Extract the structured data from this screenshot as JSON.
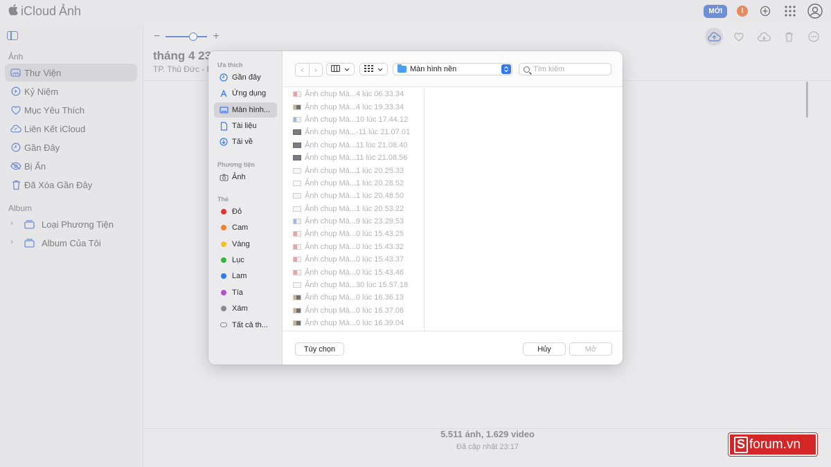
{
  "app": {
    "brand": "iCloud",
    "title": "Ảnh"
  },
  "topbar": {
    "new_badge": "MỚI",
    "warn_symbol": "!"
  },
  "sidebar": {
    "section_photos": "Ảnh",
    "items": [
      {
        "label": "Thư Viện",
        "icon": "photo-library-icon",
        "active": true
      },
      {
        "label": "Kỷ Niệm",
        "icon": "memories-icon"
      },
      {
        "label": "Mục Yêu Thích",
        "icon": "heart-icon"
      },
      {
        "label": "Liên Kết iCloud",
        "icon": "cloud-link-icon"
      },
      {
        "label": "Gần Đây",
        "icon": "clock-icon"
      },
      {
        "label": "Bị Ẩn",
        "icon": "eye-slash-icon"
      },
      {
        "label": "Đã Xóa Gần Đây",
        "icon": "trash-icon"
      }
    ],
    "section_albums": "Album",
    "albums": [
      {
        "label": "Loại Phương Tiện"
      },
      {
        "label": "Album Của Tôi"
      }
    ]
  },
  "main": {
    "zoom_minus": "−",
    "zoom_plus": "+",
    "month_title": "tháng 4 23",
    "location": "TP. Thủ Đức - F",
    "stats_count": "5.511 ảnh, 1.629 video",
    "stats_updated": "Đã cập nhật 23:17"
  },
  "dialog": {
    "favorites_label": "Ưa thích",
    "favorites": [
      {
        "label": "Gần đây",
        "icon": "clock-icon"
      },
      {
        "label": "Ứng dụng",
        "icon": "apps-icon"
      },
      {
        "label": "Màn hình...",
        "icon": "desktop-icon",
        "active": true
      },
      {
        "label": "Tài liệu",
        "icon": "document-icon"
      },
      {
        "label": "Tải về",
        "icon": "download-icon"
      }
    ],
    "media_label": "Phương tiện",
    "media": [
      {
        "label": "Ảnh",
        "icon": "camera-icon"
      }
    ],
    "tags_label": "Thẻ",
    "tags": [
      {
        "label": "Đỏ",
        "color": "#e5322d"
      },
      {
        "label": "Cam",
        "color": "#f0832a"
      },
      {
        "label": "Vàng",
        "color": "#f2be2a"
      },
      {
        "label": "Lục",
        "color": "#35b63a"
      },
      {
        "label": "Lam",
        "color": "#2f7cf2"
      },
      {
        "label": "Tía",
        "color": "#b34ed0"
      },
      {
        "label": "Xám",
        "color": "#8a8a8e"
      },
      {
        "label": "Tất cả th...",
        "color": ""
      }
    ],
    "path_label": "Màn hình nền",
    "search_placeholder": "Tìm kiếm",
    "files": [
      {
        "name": "Ảnh chụp Mà...4 lúc 06.33.34",
        "thumb": "red"
      },
      {
        "name": "Ảnh chụp Mà...4 lúc 19.33.34",
        "thumb": "mixed"
      },
      {
        "name": "Ảnh chụp Mà...10 lúc 17.44.12",
        "thumb": "blue"
      },
      {
        "name": "Ảnh chụp Mà...-11 lúc 21.07.01",
        "thumb": "dark"
      },
      {
        "name": "Ảnh chụp Mà...11 lúc 21.08.40",
        "thumb": "dark"
      },
      {
        "name": "Ảnh chụp Mà...11 lúc 21.08.56",
        "thumb": "dark"
      },
      {
        "name": "Ảnh chụp Mà...1 lúc 20.25.33",
        "thumb": "light"
      },
      {
        "name": "Ảnh chụp Mà...1 lúc 20.28.52",
        "thumb": "light"
      },
      {
        "name": "Ảnh chụp Mà...1 lúc 20.48.50",
        "thumb": "light"
      },
      {
        "name": "Ảnh chụp Mà...1 lúc 20.53.22",
        "thumb": "light"
      },
      {
        "name": "Ảnh chụp Mà...9 lúc 23.29.53",
        "thumb": "blue"
      },
      {
        "name": "Ảnh chụp Mà...0 lúc 15.43.25",
        "thumb": "red"
      },
      {
        "name": "Ảnh chụp Mà...0 lúc 15.43.32",
        "thumb": "red"
      },
      {
        "name": "Ảnh chụp Mà...0 lúc 15.43.37",
        "thumb": "red"
      },
      {
        "name": "Ảnh chụp Mà...0 lúc 15.43.46",
        "thumb": "red"
      },
      {
        "name": "Ảnh chụp Mà...30 lúc 15.57.18",
        "thumb": "light"
      },
      {
        "name": "Ảnh chụp Mà...0 lúc 16.36.13",
        "thumb": "mixed"
      },
      {
        "name": "Ảnh chụp Mà...0 lúc 16.37.06",
        "thumb": "mixed"
      },
      {
        "name": "Ảnh chụp Mà...0 lúc 16.39.04",
        "thumb": "mixed"
      }
    ],
    "options_button": "Tùy chọn",
    "cancel_button": "Hủy",
    "open_button": "Mở"
  },
  "watermark": {
    "s": "S",
    "text": "forum.vn"
  },
  "colors": {
    "accent": "#6f8ed2",
    "selection_blue": "#3478f6"
  }
}
